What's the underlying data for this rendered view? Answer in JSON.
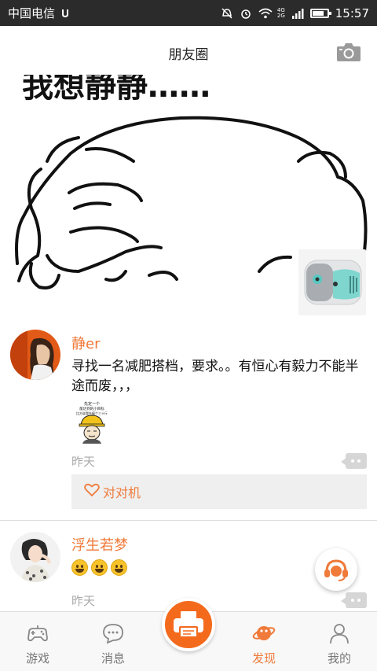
{
  "status_bar": {
    "carrier": "中国电信",
    "network_labels": [
      "4G",
      "2G"
    ],
    "time": "15:57",
    "battery_level": 0.8
  },
  "header": {
    "title": "朋友圈",
    "camera_icon": "camera-icon"
  },
  "cover": {
    "caption": "我想静静……"
  },
  "posts": [
    {
      "name": "静er",
      "text": "寻找一名减肥搭档，要求。。有恒心有毅力不能半途而废，，，",
      "sticker_text": [
        "先定一个",
        "能达到的小目标",
        "比方说我先瘦个三十斤"
      ],
      "time": "昨天",
      "likes": "对对机"
    },
    {
      "name": "浮生若梦",
      "emoji_count": 3,
      "time": "昨天"
    }
  ],
  "tabs": [
    {
      "label": "游戏",
      "icon": "gamepad-icon"
    },
    {
      "label": "消息",
      "icon": "chat-icon"
    },
    {
      "label": "发现",
      "icon": "planet-icon"
    },
    {
      "label": "我的",
      "icon": "profile-icon"
    }
  ],
  "center_button_icon": "printer-icon",
  "colors": {
    "accent": "#ef7a3a",
    "center_button": "#f46a1c",
    "status_bar": "#2b2b2b"
  }
}
